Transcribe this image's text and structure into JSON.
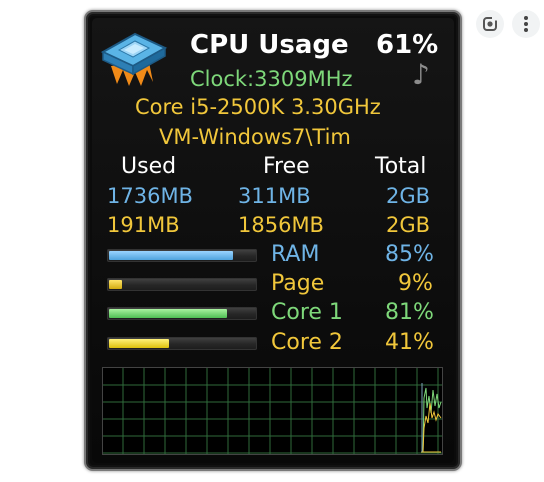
{
  "header": {
    "title": "CPU Usage",
    "cpu_percent": "61%",
    "clock": "Clock:3309MHz",
    "processor": "Core i5-2500K 3.30GHz",
    "machine": "VM-Windows7\\Tim"
  },
  "memory_table": {
    "headers": [
      "Used",
      "Free",
      "Total"
    ],
    "rows": [
      {
        "used": "1736MB",
        "free": "311MB",
        "total": "2GB",
        "color": "#6fb4e6"
      },
      {
        "used": "191MB",
        "free": "1856MB",
        "total": "2GB",
        "color": "#f1c73b"
      }
    ]
  },
  "meters": [
    {
      "label": "RAM",
      "value": "85%",
      "fraction": 0.85,
      "color": "#6fb4e6"
    },
    {
      "label": "Page",
      "value": "9%",
      "fraction": 0.09,
      "color": "#f1c73b"
    },
    {
      "label": "Core 1",
      "value": "81%",
      "fraction": 0.81,
      "color": "#7ed87a"
    },
    {
      "label": "Core 2",
      "value": "41%",
      "fraction": 0.41,
      "color": "#f1c73b"
    }
  ],
  "icons": {
    "chip": "cpu-chip-icon",
    "note": "music-note-icon",
    "lens": "lens-search-icon",
    "more": "more-vertical-icon"
  },
  "colors": {
    "background": "#0b0b0b",
    "ram": "#6fb4e6",
    "page": "#f1c73b",
    "core1": "#7ed87a",
    "core2": "#f1c73b",
    "grid": "#2f6a3a"
  }
}
